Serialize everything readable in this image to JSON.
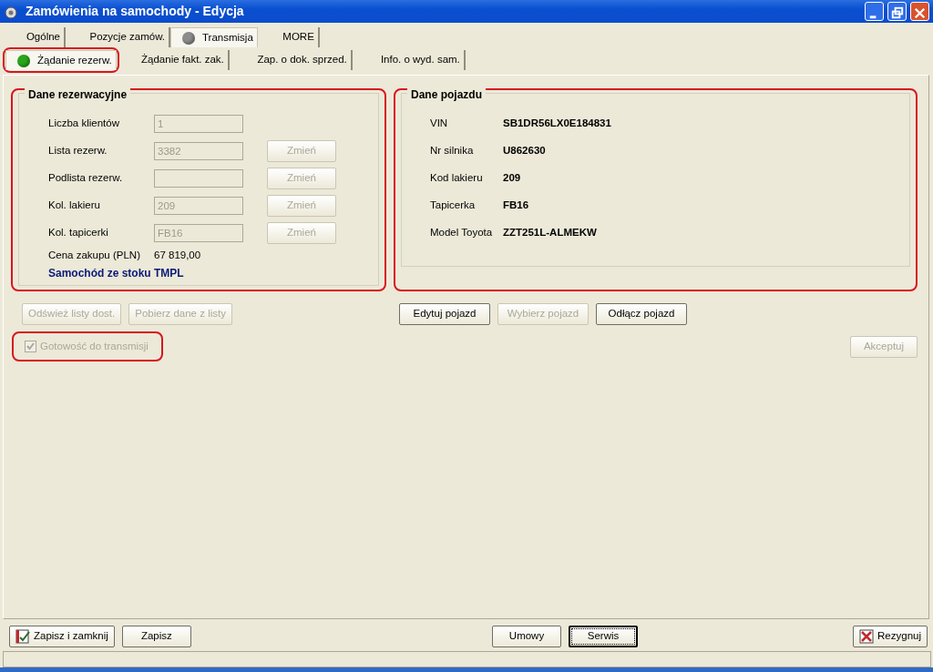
{
  "window": {
    "title": "Zamówienia na samochody - Edycja"
  },
  "tabs": [
    {
      "label": "Ogólne",
      "selected": false
    },
    {
      "label": "Pozycje zamów.",
      "selected": false
    },
    {
      "label": "Transmisja",
      "selected": true,
      "color": "#8c8c8c"
    },
    {
      "label": "MORE",
      "selected": false
    }
  ],
  "subtabs": [
    {
      "label": "Żądanie rezerw.",
      "selected": true,
      "highlighted": true,
      "color": "#2aa51a"
    },
    {
      "label": "Żądanie fakt. zak.",
      "selected": false,
      "highlighted": false
    },
    {
      "label": "Zap. o dok. sprzed.",
      "selected": false,
      "highlighted": false
    },
    {
      "label": "Info. o wyd. sam.",
      "selected": false,
      "highlighted": false
    }
  ],
  "reservation": {
    "title": "Dane rezerwacyjne",
    "highlighted": true,
    "rows": [
      {
        "kind": "field",
        "label": "Liczba klientów",
        "value": "1",
        "disabled": true
      },
      {
        "kind": "field",
        "label": "Lista rezerw.",
        "value": "3382",
        "disabled": true,
        "button": {
          "label": "Zmień",
          "disabled": true
        }
      },
      {
        "kind": "field",
        "label": "Podlista rezerw.",
        "disabled": true,
        "button": {
          "label": "Zmień",
          "disabled": true
        }
      },
      {
        "kind": "field",
        "label": "Kol. lakieru",
        "value": "209",
        "disabled": true,
        "button": {
          "label": "Zmień",
          "disabled": true
        }
      },
      {
        "kind": "field",
        "label": "Kol. tapicerki",
        "value": "FB16",
        "disabled": true,
        "button": {
          "label": "Zmień",
          "disabled": true
        }
      },
      {
        "kind": "text",
        "label": "Cena zakupu (PLN)",
        "value": "67 819,00"
      }
    ],
    "note": "Samochód ze stoku TMPL"
  },
  "vehicle": {
    "title": "Dane pojazdu",
    "highlighted": true,
    "rows": [
      {
        "label": "VIN",
        "value": "SB1DR56LX0E184831"
      },
      {
        "label": "Nr silnika",
        "value": "U862630"
      },
      {
        "label": "Kod lakieru",
        "value": "209"
      },
      {
        "label": "Tapicerka",
        "value": "FB16"
      },
      {
        "label": "Model Toyota",
        "value": "ZZT251L-ALMEKW"
      }
    ]
  },
  "left_buttons": [
    {
      "label": "Odśwież listy dost.",
      "disabled": true
    },
    {
      "label": "Pobierz dane z listy",
      "disabled": true
    }
  ],
  "vehicle_buttons": [
    {
      "label": "Edytuj pojazd",
      "disabled": false
    },
    {
      "label": "Wybierz pojazd",
      "disabled": true
    },
    {
      "label": "Odłącz pojazd",
      "disabled": false
    }
  ],
  "ready_checkbox": {
    "label": "Gotowość do transmisji",
    "checked": true,
    "disabled": true,
    "highlighted": true
  },
  "accept_button": {
    "label": "Akceptuj",
    "disabled": true
  },
  "footer": {
    "left": [
      {
        "label": "Zapisz i zamknij",
        "kind": "save",
        "default": false
      },
      {
        "label": "Zapisz",
        "kind": "plain",
        "default": false
      }
    ],
    "center": [
      {
        "label": "Umowy",
        "kind": "plain",
        "default": false
      },
      {
        "label": "Serwis",
        "kind": "plain",
        "default": true
      }
    ],
    "right": [
      {
        "label": "Rezygnuj",
        "kind": "cancel",
        "default": false
      }
    ]
  }
}
